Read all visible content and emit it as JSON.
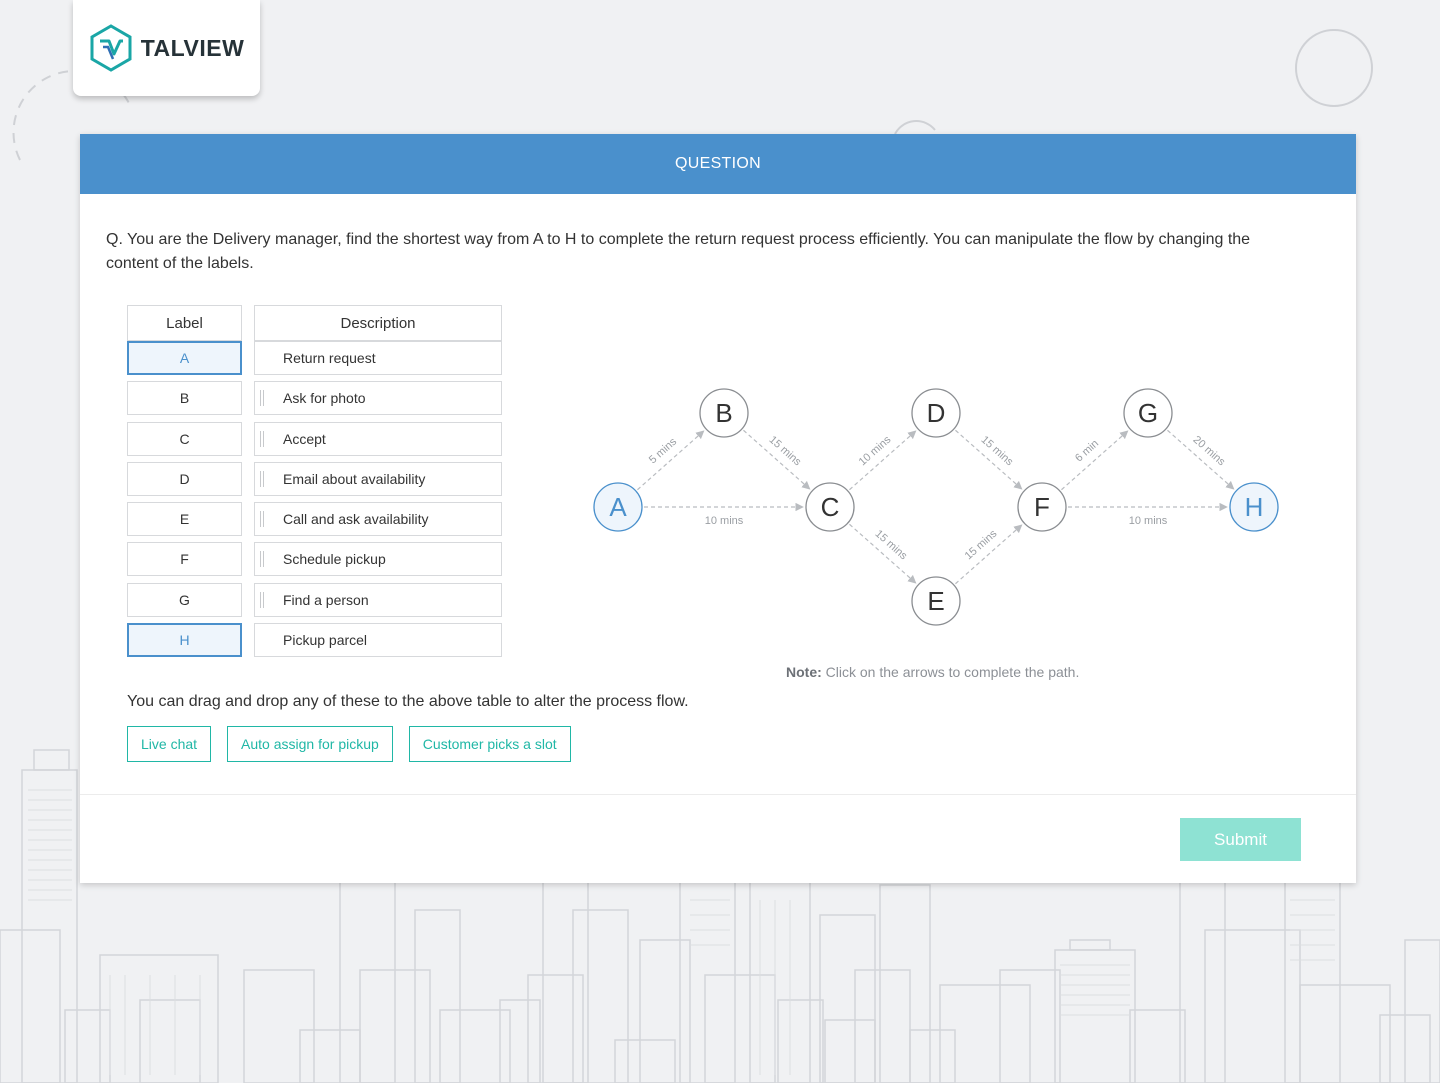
{
  "brand": {
    "name": "TALVIEW"
  },
  "header": {
    "title": "QUESTION"
  },
  "question": {
    "text": "Q. You are the Delivery manager, find the shortest way from A to H to complete the return request process efficiently. You can manipulate the flow by changing the content of the labels."
  },
  "table": {
    "label_header": "Label",
    "description_header": "Description",
    "rows": [
      {
        "label": "A",
        "description": "Return request",
        "fixed": true
      },
      {
        "label": "B",
        "description": "Ask for photo",
        "fixed": false
      },
      {
        "label": "C",
        "description": "Accept",
        "fixed": false
      },
      {
        "label": "D",
        "description": "Email about availability",
        "fixed": false
      },
      {
        "label": "E",
        "description": "Call and ask availability",
        "fixed": false
      },
      {
        "label": "F",
        "description": "Schedule pickup",
        "fixed": false
      },
      {
        "label": "G",
        "description": "Find a person",
        "fixed": false
      },
      {
        "label": "H",
        "description": "Pickup parcel",
        "fixed": true
      }
    ]
  },
  "graph": {
    "nodes": [
      "A",
      "B",
      "C",
      "D",
      "E",
      "F",
      "G",
      "H"
    ],
    "highlighted_nodes": [
      "A",
      "H"
    ],
    "edges": [
      {
        "from": "A",
        "to": "B",
        "label": "5 mins"
      },
      {
        "from": "A",
        "to": "C",
        "label": "10 mins"
      },
      {
        "from": "B",
        "to": "C",
        "label": "15 mins"
      },
      {
        "from": "C",
        "to": "D",
        "label": "10 mins"
      },
      {
        "from": "C",
        "to": "E",
        "label": "15 mins"
      },
      {
        "from": "D",
        "to": "F",
        "label": "15 mins"
      },
      {
        "from": "E",
        "to": "F",
        "label": "15 mins"
      },
      {
        "from": "F",
        "to": "G",
        "label": "6 min"
      },
      {
        "from": "F",
        "to": "H",
        "label": "10 mins"
      },
      {
        "from": "G",
        "to": "H",
        "label": "20 mins"
      }
    ],
    "note_label": "Note:",
    "note_text": " Click on the arrows to complete the path."
  },
  "drag": {
    "instruction": "You can drag and drop any of these to the above table to alter the process flow.",
    "options": [
      "Live chat",
      "Auto assign for pickup",
      "Customer picks a slot"
    ]
  },
  "submit": {
    "label": "Submit"
  },
  "colors": {
    "accent": "#4a90cc",
    "teal": "#20b7a6",
    "submit_bg": "#8ee2d3"
  }
}
